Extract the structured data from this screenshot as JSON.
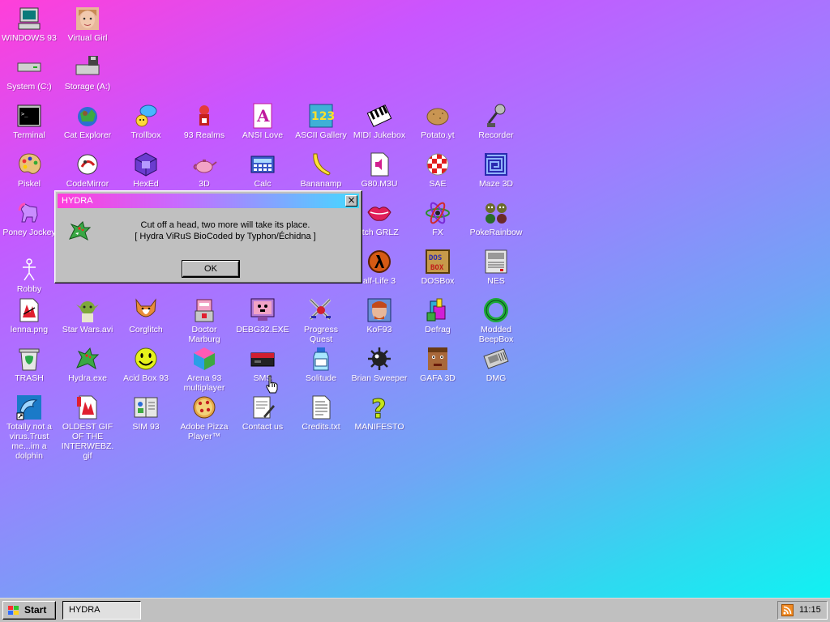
{
  "desktop": {
    "icons": [
      {
        "label": "WINDOWS 93",
        "icon": "computer-icon"
      },
      {
        "label": "Virtual Girl",
        "icon": "virtual-girl-icon"
      },
      {
        "label": "System (C:)",
        "icon": "hard-drive-icon"
      },
      {
        "label": "Storage (A:)",
        "icon": "floppy-drive-icon"
      },
      {
        "label": "Terminal",
        "icon": "terminal-icon"
      },
      {
        "label": "Cat Explorer",
        "icon": "cat-explorer-icon"
      },
      {
        "label": "Trollbox",
        "icon": "chat-bubble-icon"
      },
      {
        "label": "93 Realms",
        "icon": "realms-icon"
      },
      {
        "label": "ANSI Love",
        "icon": "ansi-letter-icon"
      },
      {
        "label": "ASCII Gallery",
        "icon": "ascii-numbers-icon"
      },
      {
        "label": "MIDI Jukebox",
        "icon": "piano-keys-icon"
      },
      {
        "label": "Potato.yt",
        "icon": "potato-icon"
      },
      {
        "label": "Recorder",
        "icon": "microphone-icon"
      },
      {
        "label": "Piskel",
        "icon": "paint-palette-icon"
      },
      {
        "label": "CodeMirror",
        "icon": "codemirror-icon"
      },
      {
        "label": "HexEd",
        "icon": "purple-cube-icon"
      },
      {
        "label": "3D",
        "icon": "teapot-icon"
      },
      {
        "label": "Calc",
        "icon": "calculator-icon"
      },
      {
        "label": "Bananamp",
        "icon": "banana-icon"
      },
      {
        "label": "G80.M3U",
        "icon": "audio-file-icon"
      },
      {
        "label": "SAE",
        "icon": "checkered-ball-icon"
      },
      {
        "label": "Maze 3D",
        "icon": "maze-icon"
      },
      {
        "label": "Poney Jockey",
        "icon": "pony-icon"
      },
      {
        "label": "itch GRLZ",
        "icon": "lips-icon"
      },
      {
        "label": "FX",
        "icon": "atom-icon"
      },
      {
        "label": "PokeRainbow",
        "icon": "pokerainbow-icon"
      },
      {
        "label": "Robby",
        "icon": "stick-figure-icon"
      },
      {
        "label": "alf-Life 3",
        "icon": "half-life-icon"
      },
      {
        "label": "DOSBox",
        "icon": "dosbox-icon"
      },
      {
        "label": "NES",
        "icon": "nes-console-icon"
      },
      {
        "label": "lenna.png",
        "icon": "image-file-icon"
      },
      {
        "label": "Star Wars.avi",
        "icon": "yoda-icon"
      },
      {
        "label": "Corglitch",
        "icon": "corgi-icon"
      },
      {
        "label": "Doctor Marburg",
        "icon": "doctor-robot-icon"
      },
      {
        "label": "DEBG32.EXE",
        "icon": "monitor-face-icon"
      },
      {
        "label": "Progress Quest",
        "icon": "crossed-swords-icon"
      },
      {
        "label": "KoF93",
        "icon": "fighter-portrait-icon"
      },
      {
        "label": "Defrag",
        "icon": "defrag-icon"
      },
      {
        "label": "Modded BeepBox",
        "icon": "green-ring-icon"
      },
      {
        "label": "TRASH",
        "icon": "trash-icon"
      },
      {
        "label": "Hydra.exe",
        "icon": "hydra-icon"
      },
      {
        "label": "Acid Box 93",
        "icon": "smiley-icon"
      },
      {
        "label": "Arena 93 multiplayer",
        "icon": "color-cube-icon"
      },
      {
        "label": "SMS",
        "icon": "sms-console-icon"
      },
      {
        "label": "Solitude",
        "icon": "solitude-bottle-icon"
      },
      {
        "label": "Brian Sweeper",
        "icon": "mine-icon"
      },
      {
        "label": "GAFA 3D",
        "icon": "doom-face-icon"
      },
      {
        "label": "DMG",
        "icon": "gameboy-cart-icon"
      },
      {
        "label": "Totally not a virus.Trust me...im a dolphin",
        "icon": "dolphin-icon"
      },
      {
        "label": "OLDEST GIF OF THE INTERWEBZ.gif",
        "icon": "gif-file-icon"
      },
      {
        "label": "SIM 93",
        "icon": "sim-book-icon"
      },
      {
        "label": "Adobe Pizza Player™",
        "icon": "pizza-icon"
      },
      {
        "label": "Contact us",
        "icon": "contact-note-icon"
      },
      {
        "label": "Credits.txt",
        "icon": "text-file-icon"
      },
      {
        "label": "MANIFESTO",
        "icon": "question-mark-icon"
      }
    ]
  },
  "dialog": {
    "title": "HYDRA",
    "close_label": "×",
    "message_line1": "Cut off a head, two more will take its place.",
    "message_line2": "[ Hydra ViRuS BioCoded by Typhon/Échidna ]",
    "ok_label": "OK"
  },
  "taskbar": {
    "start_label": "Start",
    "task_label": "HYDRA",
    "clock": "11:15"
  }
}
